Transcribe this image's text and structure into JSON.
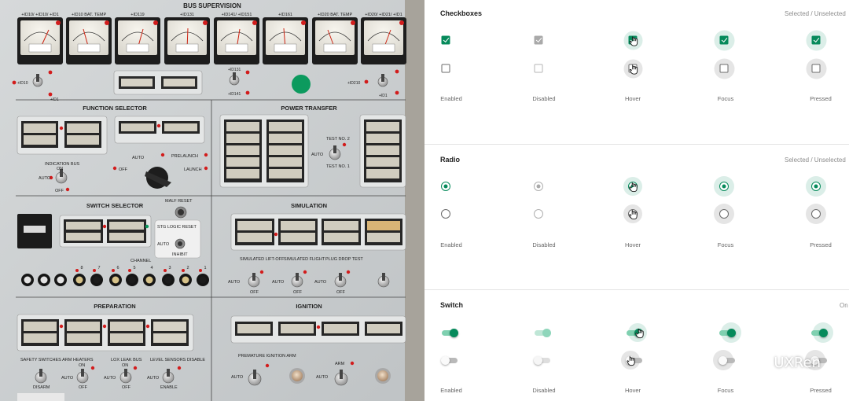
{
  "photo": {
    "header": "BUS SUPERVISION",
    "meter_labels": [
      "+ID10/ +ID10/ +ID1",
      "+ID10 BAT. TEMP",
      "+ID119",
      "+ID131",
      "+ID141/ +ID151",
      "+ID161",
      "+ID20 BAT. TEMP",
      "+ID20/ +ID21/ +ID1"
    ],
    "sections": {
      "function_selector": "FUNCTION SELECTOR",
      "power_transfer": "POWER TRANSFER",
      "switch_selector": "SWITCH SELECTOR",
      "simulation": "SIMULATION",
      "preparation": "PREPARATION",
      "ignition": "IGNITION"
    },
    "labels": {
      "auto": "AUTO",
      "off": "OFF",
      "prelaunch": "PRELAUNCH",
      "launch": "LAUNCH",
      "indication_bus": "INDICATION BUS",
      "on": "ON",
      "test_no2": "TEST NO. 2",
      "test_no1": "TEST NO. 1",
      "malf_reset": "MALF RESET",
      "stg_logic_reset": "STG LOGIC RESET",
      "inhibit": "INHIBIT",
      "channel": "CHANNEL",
      "sim_liftoff": "SIMULATED LIFT-OFF",
      "sim_flight": "SIMULATED FLIGHT",
      "plug_drop": "PLUG DROP TEST",
      "safety_switches": "SAFETY SWITCHES ARM",
      "disarm": "DISARM",
      "heaters": "HEATERS",
      "lox_leak": "LOX LEAK BUS",
      "level_sensors": "LEVEL SENSORS DISABLE",
      "enable": "ENABLE",
      "premature": "PREMATURE IGNITION ARM",
      "arm": "ARM",
      "id10": "+ID10",
      "id210": "+ID210",
      "id1": "+ID1",
      "id131": "+ID131",
      "id141": "+ID141",
      "ch8": "8",
      "ch7": "7",
      "ch6": "6",
      "ch5": "5",
      "ch4": "4",
      "ch3": "3",
      "ch2": "2",
      "ch1": "1"
    }
  },
  "sections": [
    {
      "title": "Checkboxes",
      "meta": "Selected / Unselected"
    },
    {
      "title": "Radio",
      "meta": "Selected / Unselected"
    },
    {
      "title": "Switch",
      "meta": "On / Off"
    }
  ],
  "states": [
    "Enabled",
    "Disabled",
    "Hover",
    "Focus",
    "Pressed"
  ],
  "watermark": "UXRen",
  "colors": {
    "accent": "#068a5b",
    "accent_light": "#7fd0b0",
    "disabled": "#a9a9a9",
    "text": "#222222",
    "muted": "#8c8c8c"
  }
}
